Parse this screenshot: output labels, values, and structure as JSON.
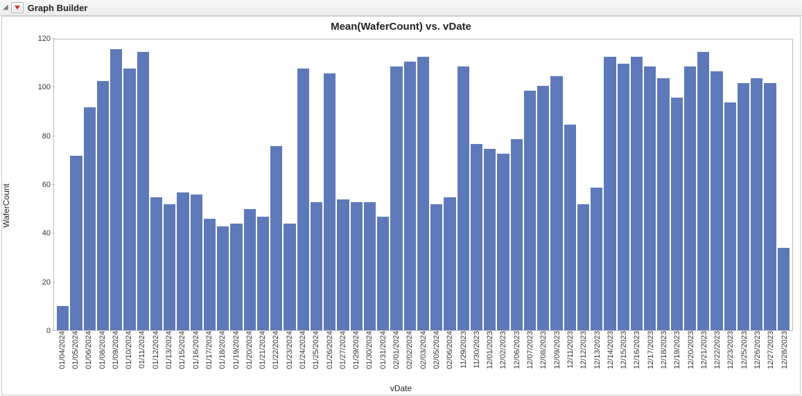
{
  "header": {
    "title": "Graph Builder"
  },
  "chart_data": {
    "type": "bar",
    "title": "Mean(WaferCount) vs. vDate",
    "xlabel": "vDate",
    "ylabel": "WaferCount",
    "ylim": [
      0,
      120
    ],
    "yticks": [
      0,
      20,
      40,
      60,
      80,
      100,
      120
    ],
    "categories": [
      "01/04/2024",
      "01/05/2024",
      "01/06/2024",
      "01/08/2024",
      "01/09/2024",
      "01/10/2024",
      "01/11/2024",
      "01/12/2024",
      "01/13/2024",
      "01/15/2024",
      "01/16/2024",
      "01/17/2024",
      "01/18/2024",
      "01/19/2024",
      "01/20/2024",
      "01/21/2024",
      "01/22/2024",
      "01/23/2024",
      "01/24/2024",
      "01/25/2024",
      "01/26/2024",
      "01/27/2024",
      "01/29/2024",
      "01/30/2024",
      "01/31/2024",
      "02/01/2024",
      "02/02/2024",
      "02/03/2024",
      "02/05/2024",
      "02/06/2024",
      "11/29/2023",
      "11/30/2023",
      "12/01/2023",
      "12/02/2023",
      "12/06/2023",
      "12/07/2023",
      "12/08/2023",
      "12/09/2023",
      "12/11/2023",
      "12/12/2023",
      "12/13/2023",
      "12/14/2023",
      "12/15/2023",
      "12/16/2023",
      "12/17/2023",
      "12/18/2023",
      "12/19/2023",
      "12/20/2023",
      "12/21/2023",
      "12/22/2023",
      "12/23/2023",
      "12/25/2023",
      "12/26/2023",
      "12/27/2023",
      "12/28/2023"
    ],
    "values": [
      10,
      72,
      92,
      103,
      116,
      108,
      115,
      55,
      52,
      57,
      56,
      46,
      43,
      44,
      50,
      47,
      76,
      44,
      108,
      53,
      106,
      54,
      53,
      53,
      47,
      109,
      111,
      113,
      52,
      55,
      109,
      77,
      75,
      73,
      79,
      99,
      101,
      105,
      85,
      52,
      59,
      113,
      110,
      113,
      109,
      104,
      96,
      109,
      115,
      107,
      94,
      102,
      104,
      102,
      34
    ]
  },
  "colors": {
    "bar": "#5e79b9"
  }
}
